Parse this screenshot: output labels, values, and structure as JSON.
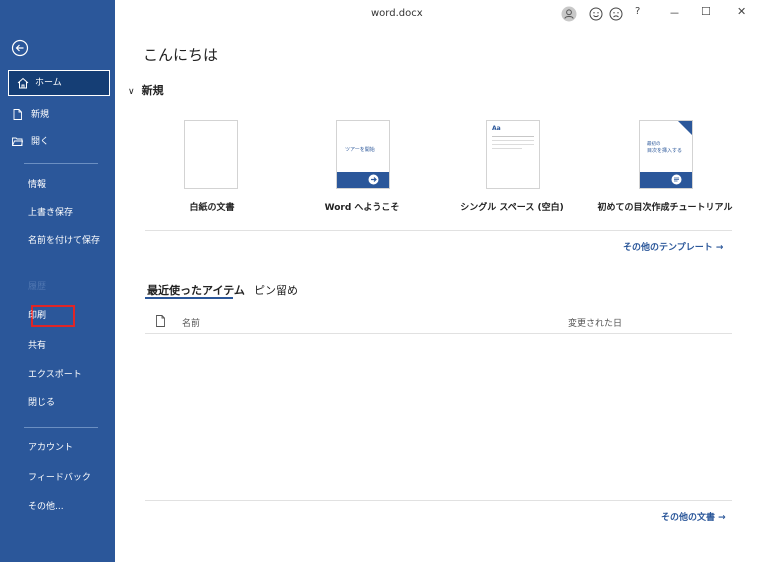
{
  "window": {
    "title": "word.docx",
    "controls": {
      "help_label": "?",
      "minimize_label": "－",
      "maximize_label": "☐",
      "close_label": "✕"
    }
  },
  "sidebar": {
    "home_label": "ホーム",
    "top_items": [
      {
        "label": "新規",
        "icon": "new-doc-icon"
      },
      {
        "label": "開く",
        "icon": "folder-icon"
      }
    ],
    "items": [
      {
        "label": "情報"
      },
      {
        "label": "上書き保存"
      },
      {
        "label": "名前を付けて保存"
      },
      {
        "label": "履歴",
        "disabled": true
      },
      {
        "label": "印刷"
      },
      {
        "label": "共有"
      },
      {
        "label": "エクスポート"
      },
      {
        "label": "閉じる"
      }
    ],
    "bottom_items": [
      {
        "label": "アカウント"
      },
      {
        "label": "フィードバック"
      },
      {
        "label": "その他..."
      }
    ]
  },
  "main": {
    "greeting": "こんにちは",
    "new_section_label": "新規",
    "templates": [
      {
        "caption": "白紙の文書"
      },
      {
        "caption": "Word へようこそ",
        "thumb_text": "ツアーを開始"
      },
      {
        "caption": "シングル スペース (空白)",
        "thumb_text": "Aa"
      },
      {
        "caption": "初めての目次作成チュートリアル",
        "thumb_text_1": "最初の",
        "thumb_text_2": "目次を挿入する"
      }
    ],
    "more_templates": "その他のテンプレート →",
    "tabs": [
      {
        "label": "最近使ったアイテム",
        "active": true
      },
      {
        "label": "ピン留め",
        "active": false
      }
    ],
    "columns": {
      "name": "名前",
      "modified": "変更された日"
    },
    "more_documents": "その他の文書 →"
  },
  "colors": {
    "sidebar": "#2b579a",
    "sidebar_selected": "#153e75",
    "accent": "#2b579a",
    "highlight_box": "#e02525"
  }
}
